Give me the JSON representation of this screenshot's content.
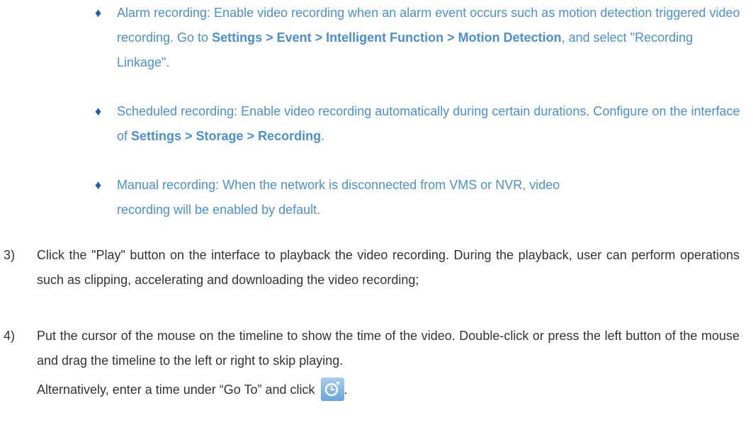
{
  "bullets": [
    {
      "text_pre": "Alarm recording: Enable video recording when an alarm event occurs such as motion detection triggered video recording. Go to ",
      "bold": "Settings > Event > Intelligent Function > Motion Detection",
      "text_post": ", and select \"Recording Linkage\"."
    },
    {
      "text_pre": "Scheduled recording: Enable video recording automatically during certain durations. Configure on the interface of ",
      "bold": "Settings > Storage > Recording",
      "text_post": "."
    },
    {
      "text_pre": "Manual recording: When the network is disconnected from VMS or NVR, video recording will be enabled by default.",
      "bold": "",
      "text_post": ""
    }
  ],
  "bullet_glyph": "♦",
  "steps": [
    {
      "number": "3)",
      "text": "Click the \"Play\" button on the interface to playback the video recording. During the playback, user can perform operations such as clipping, accelerating and downloading the video recording;"
    },
    {
      "number": "4)",
      "text": "Put the cursor of the mouse on the timeline to show the time of the video. Double-click or press the left button of the mouse and drag the timeline to the left or right to skip playing.",
      "text2": "Alternatively, enter a time under “Go To” and click",
      "text2_end": "."
    }
  ],
  "icons": {
    "goto": "clock-arrow-icon"
  },
  "colors": {
    "bullet_text": "#4a8fd6",
    "bullet_marker": "#1f5fb0",
    "body_text": "#333333"
  }
}
